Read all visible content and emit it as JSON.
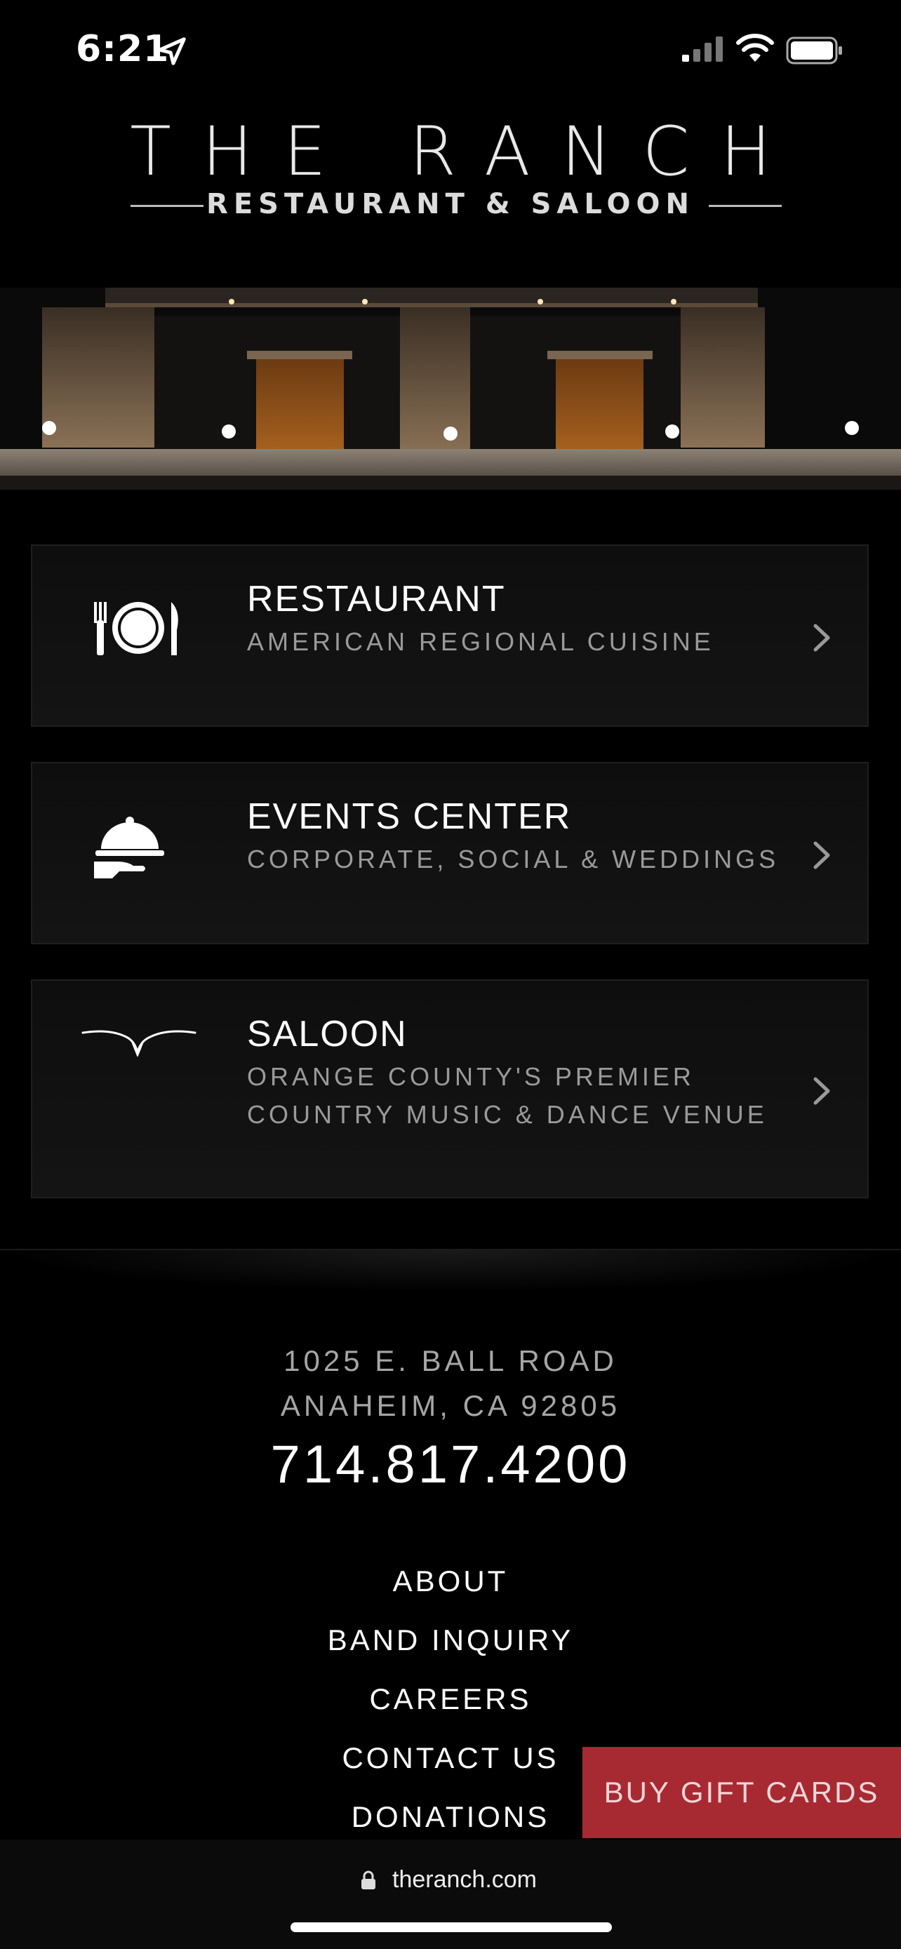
{
  "status_bar": {
    "time": "6:21",
    "icons": [
      "location-arrow-icon",
      "cellular-signal-icon",
      "wifi-icon",
      "battery-icon"
    ]
  },
  "logo": {
    "title": "THE RANCH",
    "subtitle": "RESTAURANT & SALOON"
  },
  "cards": [
    {
      "title": "RESTAURANT",
      "subtitle": [
        "AMERICAN REGIONAL CUISINE"
      ],
      "icon": "plate-cutlery-icon"
    },
    {
      "title": "EVENTS CENTER",
      "subtitle": [
        "CORPORATE, SOCIAL & WEDDINGS"
      ],
      "icon": "cloche-icon"
    },
    {
      "title": "SALOON",
      "subtitle": [
        "ORANGE COUNTY'S PREMIER",
        "COUNTRY MUSIC & DANCE VENUE"
      ],
      "icon": "longhorn-icon"
    }
  ],
  "footer": {
    "address_line1": "1025 E. BALL ROAD",
    "address_line2": "ANAHEIM, CA 92805",
    "phone": "714.817.4200",
    "links": [
      "ABOUT",
      "BAND INQUIRY",
      "CAREERS",
      "CONTACT US",
      "DONATIONS"
    ]
  },
  "gift_button": "BUY GIFT CARDS",
  "browser": {
    "url": "theranch.com"
  },
  "colors": {
    "background": "#000000",
    "accent": "#a72a33"
  }
}
